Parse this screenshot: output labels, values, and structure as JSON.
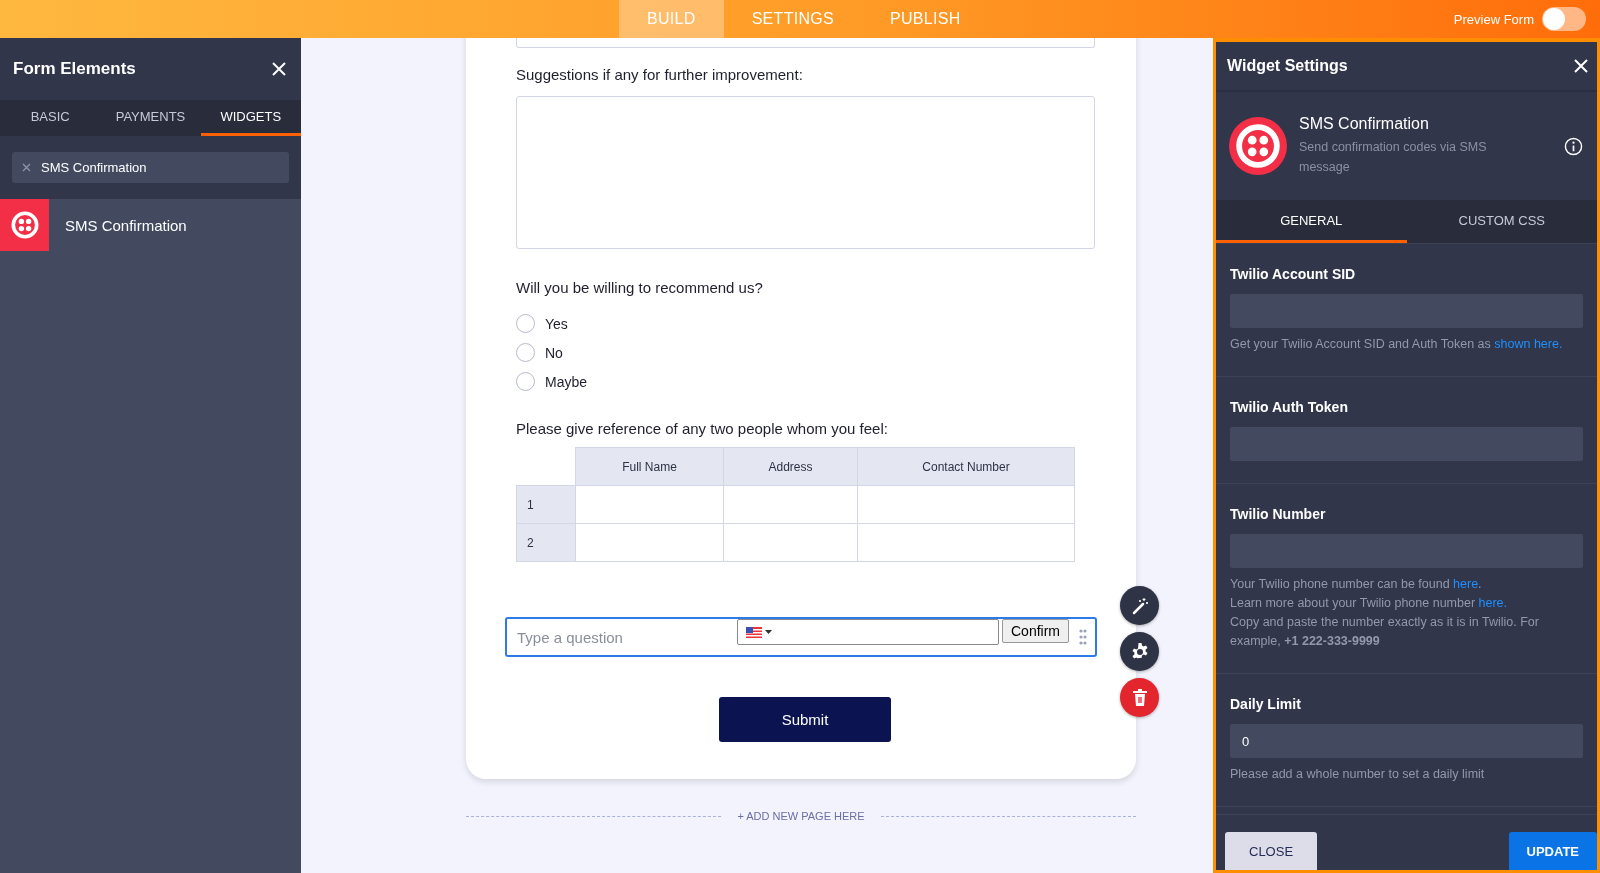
{
  "top_bar": {
    "tabs": [
      {
        "label": "BUILD",
        "selected": true
      },
      {
        "label": "SETTINGS",
        "selected": false
      },
      {
        "label": "PUBLISH",
        "selected": false
      }
    ],
    "preview_toggle": {
      "label": "Preview Form",
      "on": false
    }
  },
  "left_panel": {
    "title": "Form Elements",
    "tabs": [
      {
        "label": "BASIC",
        "selected": false
      },
      {
        "label": "PAYMENTS",
        "selected": false
      },
      {
        "label": "WIDGETS",
        "selected": true
      }
    ],
    "search": {
      "value": "SMS Confirmation"
    },
    "widgets": [
      {
        "name": "SMS Confirmation"
      }
    ]
  },
  "form": {
    "fields": [
      {
        "kind": "textarea",
        "tall": false
      },
      {
        "kind": "textarea",
        "label": "Suggestions if any for further improvement:",
        "tall": true
      },
      {
        "kind": "radio",
        "label": "Will you be willing to recommend us?",
        "options": [
          {
            "label": "Yes",
            "selected": false
          },
          {
            "label": "No",
            "selected": false
          },
          {
            "label": "Maybe",
            "selected": false
          }
        ]
      },
      {
        "kind": "matrix",
        "label": "Please give reference of any two people whom you feel:",
        "columns": [
          "Full Name",
          "Address",
          "Contact Number"
        ],
        "rows": [
          "1",
          "2"
        ]
      },
      {
        "kind": "sms",
        "placeholder": "Type a question",
        "button": "Confirm",
        "selected": true
      }
    ],
    "submit": "Submit",
    "add_page": "+ ADD NEW PAGE HERE"
  },
  "widget_settings": {
    "title": "Widget Settings",
    "widget": {
      "name": "SMS Confirmation",
      "description": "Send confirmation codes via SMS message"
    },
    "tabs": [
      {
        "label": "GENERAL",
        "selected": true
      },
      {
        "label": "CUSTOM CSS",
        "selected": false
      }
    ],
    "fields": [
      {
        "label": "Twilio Account SID",
        "hint": [
          [
            {
              "text": "Get your Twilio Account SID and Auth Token as ",
              "link": false
            },
            {
              "text": "shown here.",
              "link": true
            }
          ]
        ]
      },
      {
        "label": "Twilio Auth Token"
      },
      {
        "label": "Twilio Number",
        "hint": [
          [
            {
              "text": "Your Twilio phone number can be found ",
              "link": false
            },
            {
              "text": "here",
              "link": true
            },
            {
              "text": ".",
              "link": false
            }
          ],
          [
            {
              "text": "Learn more about your Twilio phone number ",
              "link": false
            },
            {
              "text": "here.",
              "link": true
            }
          ],
          [
            {
              "text": "Copy and paste the number exactly as it is in Twilio. For example, **+1 222-333-9999**",
              "link": false
            }
          ]
        ]
      },
      {
        "label": "Daily Limit",
        "value": "0",
        "hint": [
          [
            {
              "text": "Please add a whole number to set a daily limit",
              "link": false
            }
          ]
        ]
      }
    ],
    "buttons": [
      {
        "label": "CLOSE",
        "kind": "secondary"
      },
      {
        "label": "UPDATE",
        "kind": "primary"
      }
    ]
  }
}
